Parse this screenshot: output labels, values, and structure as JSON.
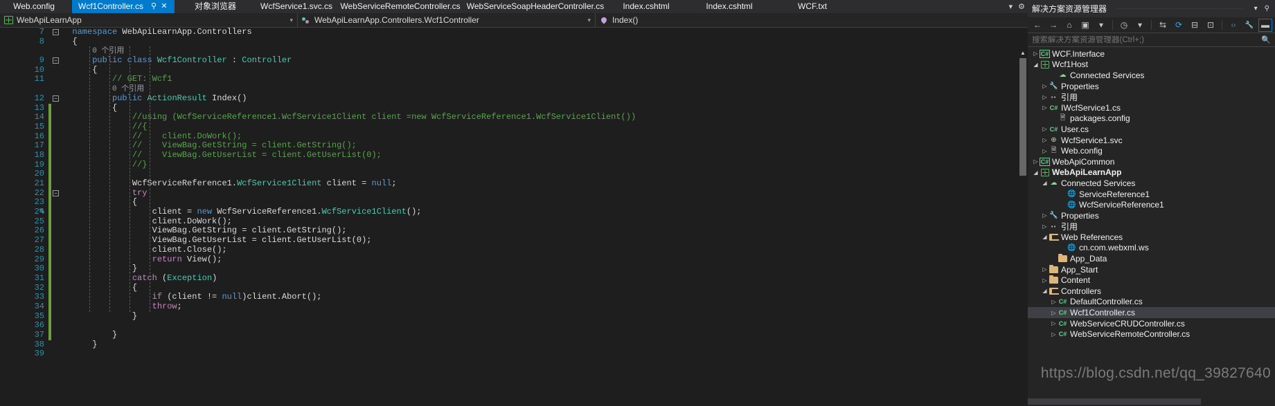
{
  "tabs": [
    {
      "label": "Web.config",
      "active": false
    },
    {
      "label": "Wcf1Controller.cs",
      "active": true,
      "pin": "⚲",
      "close": "✕"
    },
    {
      "label": "对象浏览器",
      "active": false
    },
    {
      "label": "WcfService1.svc.cs",
      "active": false
    },
    {
      "label": "WebServiceRemoteController.cs",
      "active": false
    },
    {
      "label": "WebServiceSoapHeaderController.cs",
      "active": false
    },
    {
      "label": "Index.cshtml",
      "active": false
    },
    {
      "label": "Index.cshtml",
      "active": false
    },
    {
      "label": "WCF.txt",
      "active": false
    }
  ],
  "tabstrip_right": {
    "dropdown_icon": "▾",
    "settings_icon": "⚙"
  },
  "navbar": {
    "project": "WebApiLearnApp",
    "project_icon": "project-icon",
    "member": "WebApiLearnApp.Controllers.Wcf1Controller",
    "member_icon": "class-icon",
    "method": "Index()",
    "method_icon": "method-icon",
    "caret": "▾"
  },
  "editor": {
    "current_line": 21,
    "lines": [
      {
        "n": "7",
        "type": "code",
        "collapse": "minus",
        "indent": 0,
        "tokens": [
          {
            "t": "namespace ",
            "c": "k"
          },
          {
            "t": "WebApiLearnApp.Controllers",
            "c": "p"
          }
        ]
      },
      {
        "n": "8",
        "type": "code",
        "indent": 0,
        "tokens": [
          {
            "t": "{",
            "c": "p"
          }
        ]
      },
      {
        "n": "",
        "type": "codelens",
        "indent": 1,
        "text": "0 个引用"
      },
      {
        "n": "9",
        "type": "code",
        "collapse": "minus",
        "indent": 1,
        "tokens": [
          {
            "t": "public ",
            "c": "k"
          },
          {
            "t": "class ",
            "c": "k"
          },
          {
            "t": "Wcf1Controller",
            "c": "t"
          },
          {
            "t": " : ",
            "c": "p"
          },
          {
            "t": "Controller",
            "c": "t"
          }
        ]
      },
      {
        "n": "10",
        "type": "code",
        "indent": 1,
        "tokens": [
          {
            "t": "{",
            "c": "p"
          }
        ]
      },
      {
        "n": "11",
        "type": "code",
        "indent": 2,
        "tokens": [
          {
            "t": "// GET: Wcf1",
            "c": "c"
          }
        ]
      },
      {
        "n": "",
        "type": "codelens",
        "indent": 2,
        "text": "0 个引用"
      },
      {
        "n": "12",
        "type": "code",
        "collapse": "minus",
        "indent": 2,
        "tokens": [
          {
            "t": "public ",
            "c": "k"
          },
          {
            "t": "ActionResult",
            "c": "t"
          },
          {
            "t": " Index()",
            "c": "p"
          }
        ]
      },
      {
        "n": "13",
        "type": "code",
        "indent": 2,
        "tokens": [
          {
            "t": "{",
            "c": "p"
          }
        ]
      },
      {
        "n": "14",
        "type": "code",
        "indent": 3,
        "tokens": [
          {
            "t": "//using (WcfServiceReference1.WcfService1Client client =new WcfServiceReference1.WcfService1Client())",
            "c": "c"
          }
        ]
      },
      {
        "n": "15",
        "type": "code",
        "indent": 3,
        "tokens": [
          {
            "t": "//{",
            "c": "c"
          }
        ]
      },
      {
        "n": "16",
        "type": "code",
        "indent": 3,
        "tokens": [
          {
            "t": "//    client.DoWork();",
            "c": "c"
          }
        ]
      },
      {
        "n": "17",
        "type": "code",
        "indent": 3,
        "tokens": [
          {
            "t": "//    ViewBag.GetString = client.GetString();",
            "c": "c"
          }
        ]
      },
      {
        "n": "18",
        "type": "code",
        "indent": 3,
        "tokens": [
          {
            "t": "//    ViewBag.GetUserList = client.GetUserList(0);",
            "c": "c"
          }
        ]
      },
      {
        "n": "19",
        "type": "code",
        "indent": 3,
        "tokens": [
          {
            "t": "//}",
            "c": "c"
          }
        ]
      },
      {
        "n": "20",
        "type": "code",
        "indent": 3,
        "tokens": [
          {
            "t": "",
            "c": "p"
          }
        ]
      },
      {
        "n": "21",
        "type": "code",
        "indent": 3,
        "current": true,
        "tokens": [
          {
            "t": "WcfServiceReference1.",
            "c": "p"
          },
          {
            "t": "WcfService1Client",
            "c": "t"
          },
          {
            "t": " client = ",
            "c": "p"
          },
          {
            "t": "null",
            "c": "k"
          },
          {
            "t": ";",
            "c": "p"
          }
        ]
      },
      {
        "n": "22",
        "type": "code",
        "collapse": "minus",
        "indent": 3,
        "tokens": [
          {
            "t": "try",
            "c": "kc"
          }
        ]
      },
      {
        "n": "23",
        "type": "code",
        "indent": 3,
        "tokens": [
          {
            "t": "{",
            "c": "p"
          }
        ]
      },
      {
        "n": "24",
        "type": "code",
        "indent": 4,
        "tokens": [
          {
            "t": "client = ",
            "c": "p"
          },
          {
            "t": "new ",
            "c": "k"
          },
          {
            "t": "WcfServiceReference1.",
            "c": "p"
          },
          {
            "t": "WcfService1Client",
            "c": "t"
          },
          {
            "t": "();",
            "c": "p"
          }
        ]
      },
      {
        "n": "25",
        "type": "code",
        "indent": 4,
        "tokens": [
          {
            "t": "client.DoWork();",
            "c": "p"
          }
        ]
      },
      {
        "n": "26",
        "type": "code",
        "indent": 4,
        "tokens": [
          {
            "t": "ViewBag.GetString = client.GetString();",
            "c": "p"
          }
        ]
      },
      {
        "n": "27",
        "type": "code",
        "indent": 4,
        "tokens": [
          {
            "t": "ViewBag.GetUserList = client.GetUserList(0);",
            "c": "p"
          }
        ]
      },
      {
        "n": "28",
        "type": "code",
        "indent": 4,
        "tokens": [
          {
            "t": "client.Close();",
            "c": "p"
          }
        ]
      },
      {
        "n": "29",
        "type": "code",
        "indent": 4,
        "tokens": [
          {
            "t": "return ",
            "c": "kc"
          },
          {
            "t": "View();",
            "c": "p"
          }
        ]
      },
      {
        "n": "30",
        "type": "code",
        "indent": 3,
        "tokens": [
          {
            "t": "}",
            "c": "p"
          }
        ]
      },
      {
        "n": "31",
        "type": "code",
        "indent": 3,
        "tokens": [
          {
            "t": "catch ",
            "c": "kc"
          },
          {
            "t": "(",
            "c": "p"
          },
          {
            "t": "Exception",
            "c": "t"
          },
          {
            "t": ")",
            "c": "p"
          }
        ]
      },
      {
        "n": "32",
        "type": "code",
        "indent": 3,
        "tokens": [
          {
            "t": "{",
            "c": "p"
          }
        ]
      },
      {
        "n": "33",
        "type": "code",
        "indent": 4,
        "tokens": [
          {
            "t": "if ",
            "c": "kc"
          },
          {
            "t": "(client != ",
            "c": "p"
          },
          {
            "t": "null",
            "c": "k"
          },
          {
            "t": ")client.Abort();",
            "c": "p"
          }
        ]
      },
      {
        "n": "34",
        "type": "code",
        "indent": 4,
        "tokens": [
          {
            "t": "throw",
            "c": "kc"
          },
          {
            "t": ";",
            "c": "p"
          }
        ]
      },
      {
        "n": "35",
        "type": "code",
        "indent": 3,
        "tokens": [
          {
            "t": "}",
            "c": "p"
          }
        ]
      },
      {
        "n": "36",
        "type": "code",
        "indent": 3,
        "tokens": [
          {
            "t": "",
            "c": "p"
          }
        ]
      },
      {
        "n": "37",
        "type": "code",
        "indent": 2,
        "tokens": [
          {
            "t": "}",
            "c": "p"
          }
        ]
      },
      {
        "n": "38",
        "type": "code",
        "indent": 1,
        "tokens": [
          {
            "t": "}",
            "c": "p"
          }
        ]
      },
      {
        "n": "39",
        "type": "code",
        "indent": 0,
        "tokens": [
          {
            "t": "",
            "c": "p"
          }
        ]
      }
    ]
  },
  "solution_explorer": {
    "title": "解决方案资源管理器",
    "title_dropdown_icon": "▾",
    "title_pin_icon": "⚲",
    "toolbar": [
      {
        "name": "back-icon",
        "glyph": "←"
      },
      {
        "name": "forward-icon",
        "glyph": "→"
      },
      {
        "name": "home-icon",
        "glyph": "⌂"
      },
      {
        "name": "pending-changes-icon",
        "glyph": "▣"
      },
      {
        "name": "dropdown-icon",
        "glyph": "▾"
      },
      {
        "name": "history-icon",
        "glyph": "◷"
      },
      {
        "name": "dropdown2-icon",
        "glyph": "▾"
      },
      {
        "name": "sync-icon",
        "glyph": "⇆"
      },
      {
        "name": "refresh-icon",
        "glyph": "⟳"
      },
      {
        "name": "collapse-all-icon",
        "glyph": "⊟"
      },
      {
        "name": "show-all-files-icon",
        "glyph": "⊡"
      },
      {
        "name": "view-code-icon",
        "glyph": "‹›"
      },
      {
        "name": "properties-icon",
        "glyph": "🔧"
      },
      {
        "name": "preview-icon",
        "glyph": "▬"
      }
    ],
    "search_placeholder": "搜索解决方案资源管理器(Ctrl+;)",
    "search_value": "",
    "search_icon": "search-icon",
    "tree": [
      {
        "label": "WCF.Interface",
        "depth": 1,
        "exp": "collapsed",
        "icon": "cs-project"
      },
      {
        "label": "Wcf1Host",
        "depth": 1,
        "exp": "expanded",
        "icon": "web-project"
      },
      {
        "label": "Connected Services",
        "depth": 3,
        "exp": "none",
        "icon": "cloud"
      },
      {
        "label": "Properties",
        "depth": 2,
        "exp": "collapsed",
        "icon": "wrench"
      },
      {
        "label": "引用",
        "depth": 2,
        "exp": "collapsed",
        "icon": "references"
      },
      {
        "label": "IWcfService1.cs",
        "depth": 2,
        "exp": "collapsed",
        "icon": "cs-file"
      },
      {
        "label": "packages.config",
        "depth": 3,
        "exp": "none",
        "icon": "config"
      },
      {
        "label": "User.cs",
        "depth": 2,
        "exp": "collapsed",
        "icon": "cs-file"
      },
      {
        "label": "WcfService1.svc",
        "depth": 2,
        "exp": "collapsed",
        "icon": "svc"
      },
      {
        "label": "Web.config",
        "depth": 2,
        "exp": "collapsed",
        "icon": "config"
      },
      {
        "label": "WebApiCommon",
        "depth": 1,
        "exp": "collapsed",
        "icon": "cs-project"
      },
      {
        "label": "WebApiLearnApp",
        "depth": 1,
        "exp": "expanded",
        "icon": "web-project",
        "bold": true
      },
      {
        "label": "Connected Services",
        "depth": 2,
        "exp": "expanded",
        "icon": "cloud"
      },
      {
        "label": "ServiceReference1",
        "depth": 4,
        "exp": "none",
        "icon": "svcref"
      },
      {
        "label": "WcfServiceReference1",
        "depth": 4,
        "exp": "none",
        "icon": "svcref"
      },
      {
        "label": "Properties",
        "depth": 2,
        "exp": "collapsed",
        "icon": "wrench"
      },
      {
        "label": "引用",
        "depth": 2,
        "exp": "collapsed",
        "icon": "references"
      },
      {
        "label": "Web References",
        "depth": 2,
        "exp": "expanded",
        "icon": "folder-open"
      },
      {
        "label": "cn.com.webxml.ws",
        "depth": 4,
        "exp": "none",
        "icon": "svcref"
      },
      {
        "label": "App_Data",
        "depth": 3,
        "exp": "none",
        "icon": "folder"
      },
      {
        "label": "App_Start",
        "depth": 2,
        "exp": "collapsed",
        "icon": "folder"
      },
      {
        "label": "Content",
        "depth": 2,
        "exp": "collapsed",
        "icon": "folder"
      },
      {
        "label": "Controllers",
        "depth": 2,
        "exp": "expanded",
        "icon": "folder-open"
      },
      {
        "label": "DefaultController.cs",
        "depth": 3,
        "exp": "collapsed",
        "icon": "cs-file"
      },
      {
        "label": "Wcf1Controller.cs",
        "depth": 3,
        "exp": "collapsed",
        "icon": "cs-file",
        "selected": true
      },
      {
        "label": "WebServiceCRUDController.cs",
        "depth": 3,
        "exp": "collapsed",
        "icon": "cs-file"
      },
      {
        "label": "WebServiceRemoteController.cs",
        "depth": 3,
        "exp": "collapsed",
        "icon": "cs-file"
      }
    ]
  },
  "watermark": "https://blog.csdn.net/qq_39827640",
  "colors": {
    "accent": "#007acc",
    "tab_active_bg": "#007acc",
    "chrome_bg": "#2d2d30",
    "panel_bg": "#252526",
    "editor_bg": "#1e1e1e",
    "line_number": "#2b91af",
    "comment": "#57a64a",
    "keyword": "#569cd6",
    "control_keyword": "#c586c0",
    "type": "#4ec9b0",
    "changebar_saved": "#6d9f3f",
    "selection": "#3f3f46"
  }
}
